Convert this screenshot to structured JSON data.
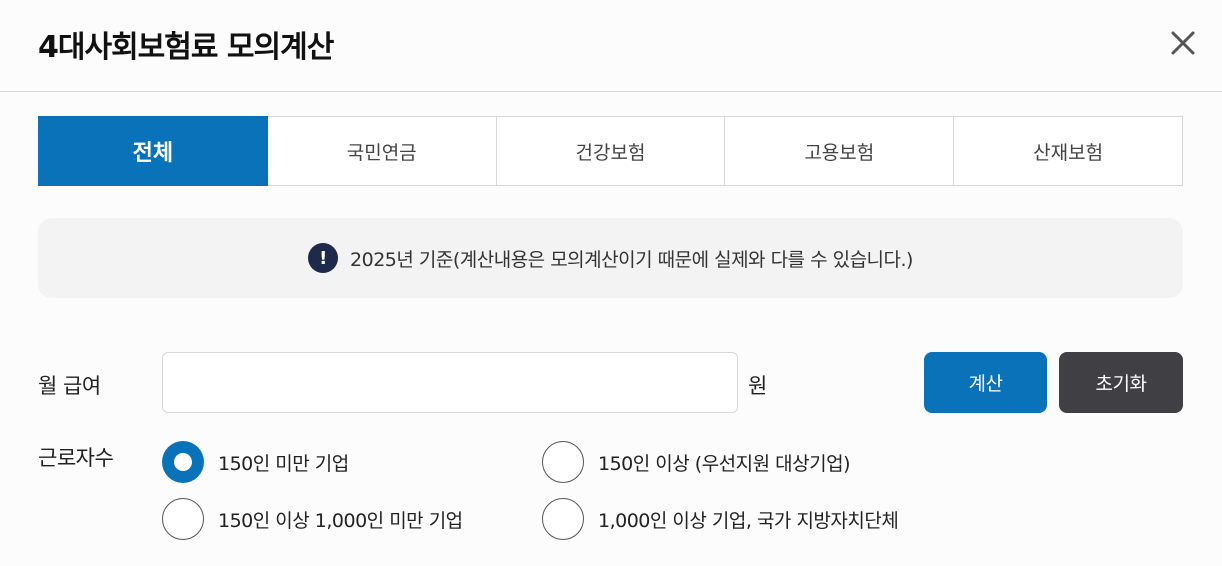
{
  "header": {
    "title": "4대사회보험료 모의계산"
  },
  "tabs": [
    {
      "label": "전체",
      "active": true
    },
    {
      "label": "국민연금",
      "active": false
    },
    {
      "label": "건강보험",
      "active": false
    },
    {
      "label": "고용보험",
      "active": false
    },
    {
      "label": "산재보험",
      "active": false
    }
  ],
  "notice": {
    "icon": "!",
    "text": "2025년 기준(계산내용은 모의계산이기 때문에 실제와 다를 수 있습니다.)"
  },
  "form": {
    "salary_label": "월 급여",
    "salary_value": "",
    "salary_unit": "원",
    "calc_button": "계산",
    "reset_button": "초기화",
    "workers_label": "근로자수",
    "worker_options": [
      {
        "label": "150인 미만 기업",
        "checked": true
      },
      {
        "label": "150인 이상 (우선지원 대상기업)",
        "checked": false
      },
      {
        "label": "150인 이상 1,000인 미만 기업",
        "checked": false
      },
      {
        "label": "1,000인 이상 기업, 국가 지방자치단체",
        "checked": false
      }
    ]
  },
  "colors": {
    "accent": "#0a72b8",
    "dark_button": "#3f3f44",
    "notice_icon": "#1e2a4a"
  }
}
